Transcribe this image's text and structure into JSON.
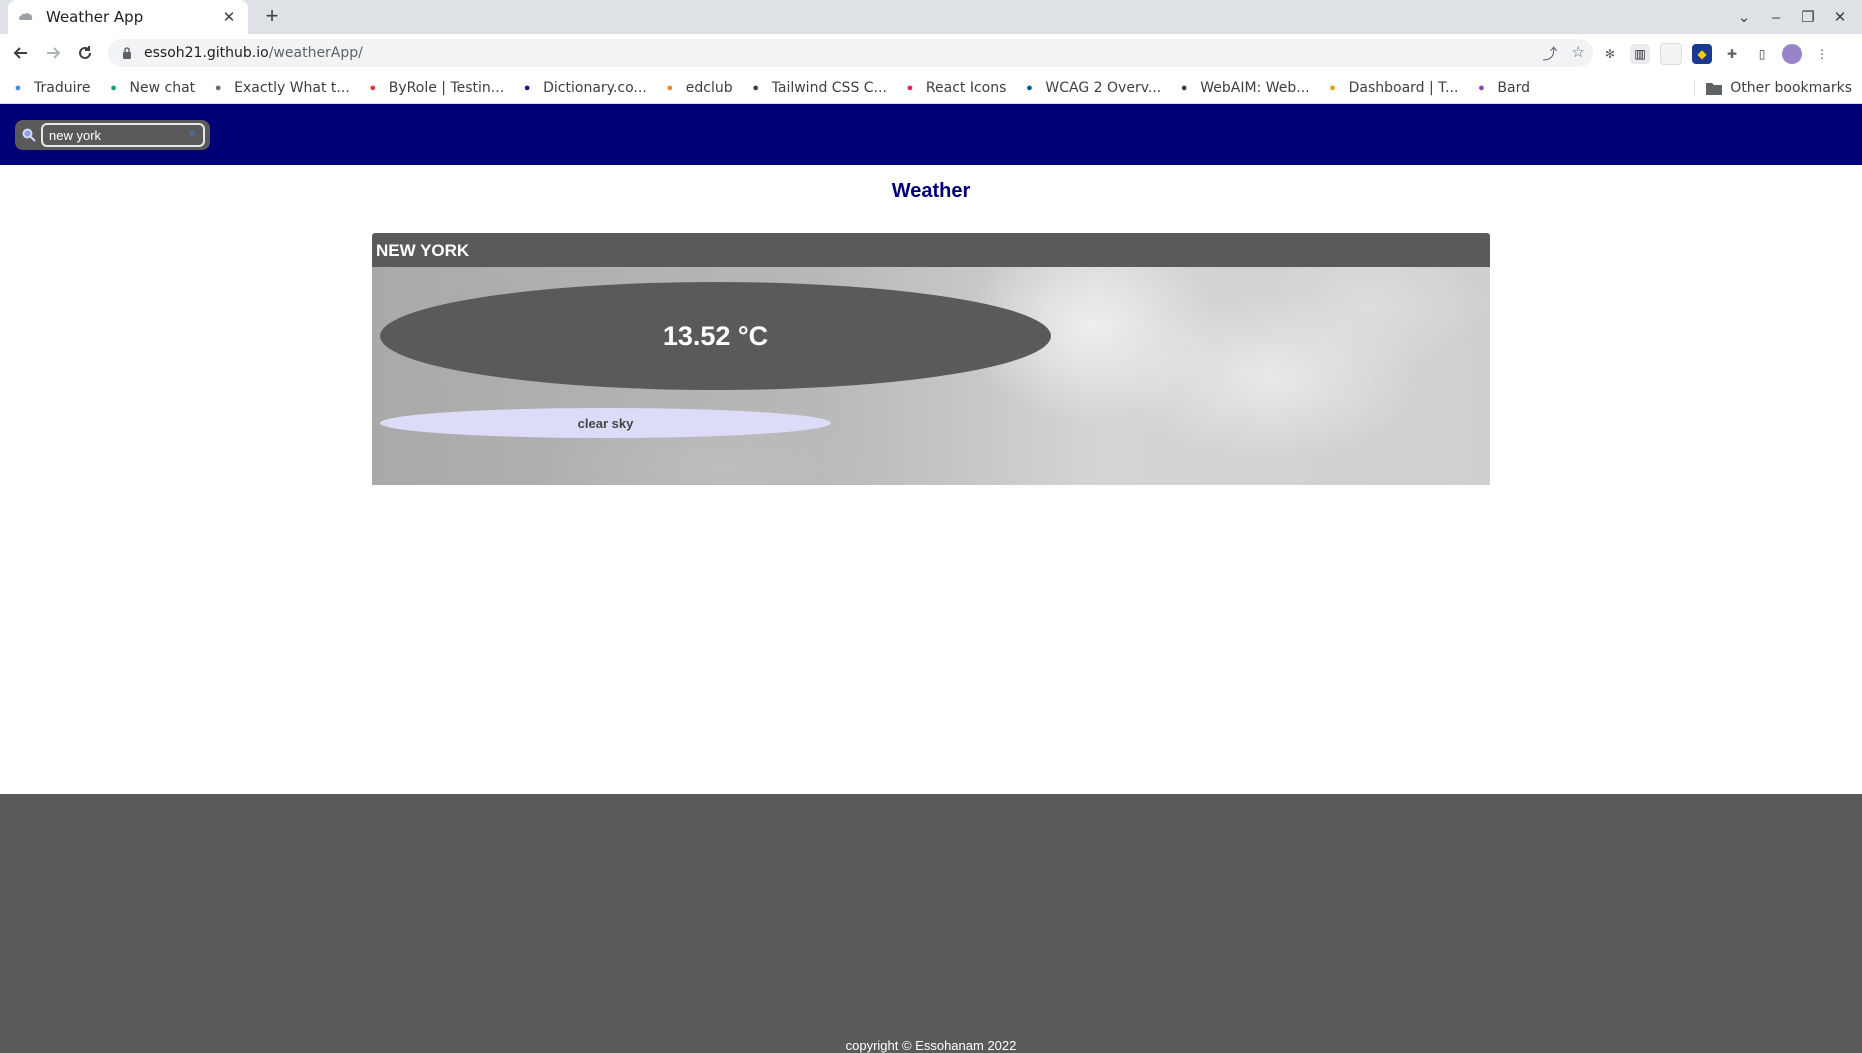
{
  "browser": {
    "tab_title": "Weather App",
    "new_tab_label": "+",
    "url_host": "essoh21.github.io",
    "url_path": "/weatherApp/",
    "bookmarks": [
      {
        "label": "Traduire",
        "icon": "translate-icon",
        "color": "#4285f4"
      },
      {
        "label": "New chat",
        "icon": "chatgpt-icon",
        "color": "#10a37f"
      },
      {
        "label": "Exactly What t...",
        "icon": "y-icon",
        "color": "#6b6b6b"
      },
      {
        "label": "ByRole | Testin...",
        "icon": "octopus-icon",
        "color": "#e33b3b"
      },
      {
        "label": "Dictionary.co...",
        "icon": "dictionary-icon",
        "color": "#0a1f8f"
      },
      {
        "label": "edclub",
        "icon": "edclub-icon",
        "color": "#f08a24"
      },
      {
        "label": "Tailwind CSS C...",
        "icon": "search-icon",
        "color": "#3c4043"
      },
      {
        "label": "React Icons",
        "icon": "react-icon",
        "color": "#e91e63"
      },
      {
        "label": "WCAG 2 Overv...",
        "icon": "w3c-icon",
        "color": "#005a9c"
      },
      {
        "label": "WebAIM: Web...",
        "icon": "globe-icon",
        "color": "#3c4043"
      },
      {
        "label": "Dashboard | T...",
        "icon": "dashboard-icon",
        "color": "#e0a400"
      },
      {
        "label": "Bard",
        "icon": "bard-icon",
        "color": "#8e44ad"
      }
    ],
    "other_bookmarks": "Other bookmarks"
  },
  "app": {
    "search": {
      "value": "new york",
      "placeholder": ""
    },
    "title": "Weather",
    "city": "NEW YORK",
    "temperature": "13.52 °C",
    "description": "clear sky",
    "copyright": "copyright © Essohanam 2022"
  },
  "colors": {
    "header_bg": "#000077",
    "title": "#000077",
    "panel_gray": "#5a5a5a",
    "desc_pill": "#dcdcf8"
  }
}
